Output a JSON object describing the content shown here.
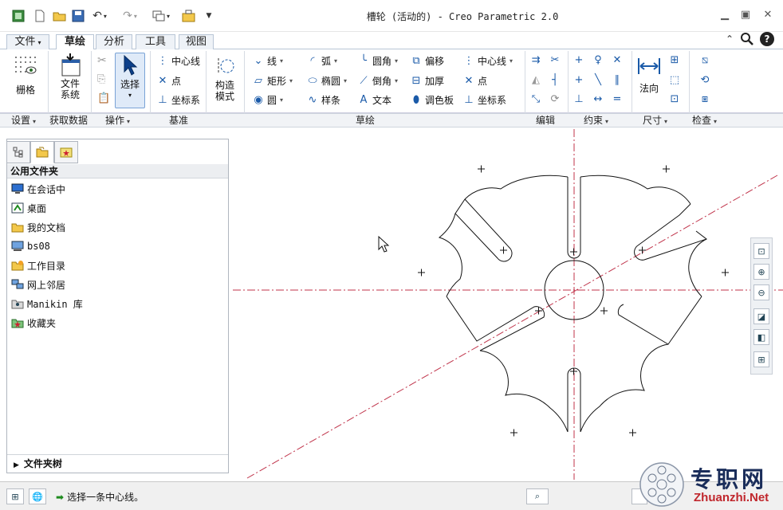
{
  "app": {
    "title": "槽轮 (活动的) - Creo Parametric 2.0",
    "window_controls": [
      "minimize-icon",
      "restore-icon",
      "close-icon"
    ]
  },
  "quick_access": [
    "app-icon",
    "new-icon",
    "open-icon",
    "save-icon",
    "undo-icon",
    "redo-icon",
    "windows-icon",
    "close-window-icon",
    "customize-icon"
  ],
  "tabs": [
    {
      "label": "文件",
      "dropdown": true
    },
    {
      "label": "草绘",
      "active": true
    },
    {
      "label": "分析"
    },
    {
      "label": "工具"
    },
    {
      "label": "视图"
    }
  ],
  "ribbon": {
    "grid": {
      "label": "栅格"
    },
    "file_system": {
      "label_line1": "文件",
      "label_line2": "系统"
    },
    "select": {
      "label": "选择"
    },
    "datum": {
      "centerline": "中心线",
      "point": "点",
      "csys": "坐标系"
    },
    "construction": {
      "label_line1": "构造",
      "label_line2": "模式"
    },
    "sketch": {
      "line": "线",
      "arc": "弧",
      "fillet": "圆角",
      "offset": "偏移",
      "rectangle": "矩形",
      "ellipse": "椭圆",
      "chamfer": "倒角",
      "thicken": "加厚",
      "circle": "圆",
      "spline": "样条",
      "text": "文本",
      "palette": "调色板",
      "centerline": "中心线",
      "point": "点",
      "csys": "坐标系"
    },
    "dimension": {
      "normal": "法向"
    }
  },
  "groups": [
    {
      "label": "设置",
      "dropdown": true
    },
    {
      "label": "获取数据"
    },
    {
      "label": "操作",
      "dropdown": true
    },
    {
      "label": "基准"
    },
    {
      "label": "草绘"
    },
    {
      "label": "编辑"
    },
    {
      "label": "约束",
      "dropdown": true
    },
    {
      "label": "尺寸",
      "dropdown": true
    },
    {
      "label": "检查",
      "dropdown": true
    }
  ],
  "left_panel": {
    "header": "公用文件夹",
    "items": [
      {
        "label": "在会话中",
        "icon": "session-icon"
      },
      {
        "label": "桌面",
        "icon": "desktop-icon"
      },
      {
        "label": "我的文档",
        "icon": "documents-icon"
      },
      {
        "label": "bs08",
        "icon": "computer-icon"
      },
      {
        "label": "工作目录",
        "icon": "working-directory-icon"
      },
      {
        "label": "网上邻居",
        "icon": "network-icon"
      },
      {
        "label": "Manikin 库",
        "icon": "manikin-library-icon"
      },
      {
        "label": "收藏夹",
        "icon": "favorites-icon"
      }
    ],
    "footer": "文件夹树"
  },
  "status": {
    "message": "选择一条中心线。"
  },
  "watermark": {
    "brand_cn": "专职网",
    "brand_url": "Zhuanzhi.Net"
  }
}
